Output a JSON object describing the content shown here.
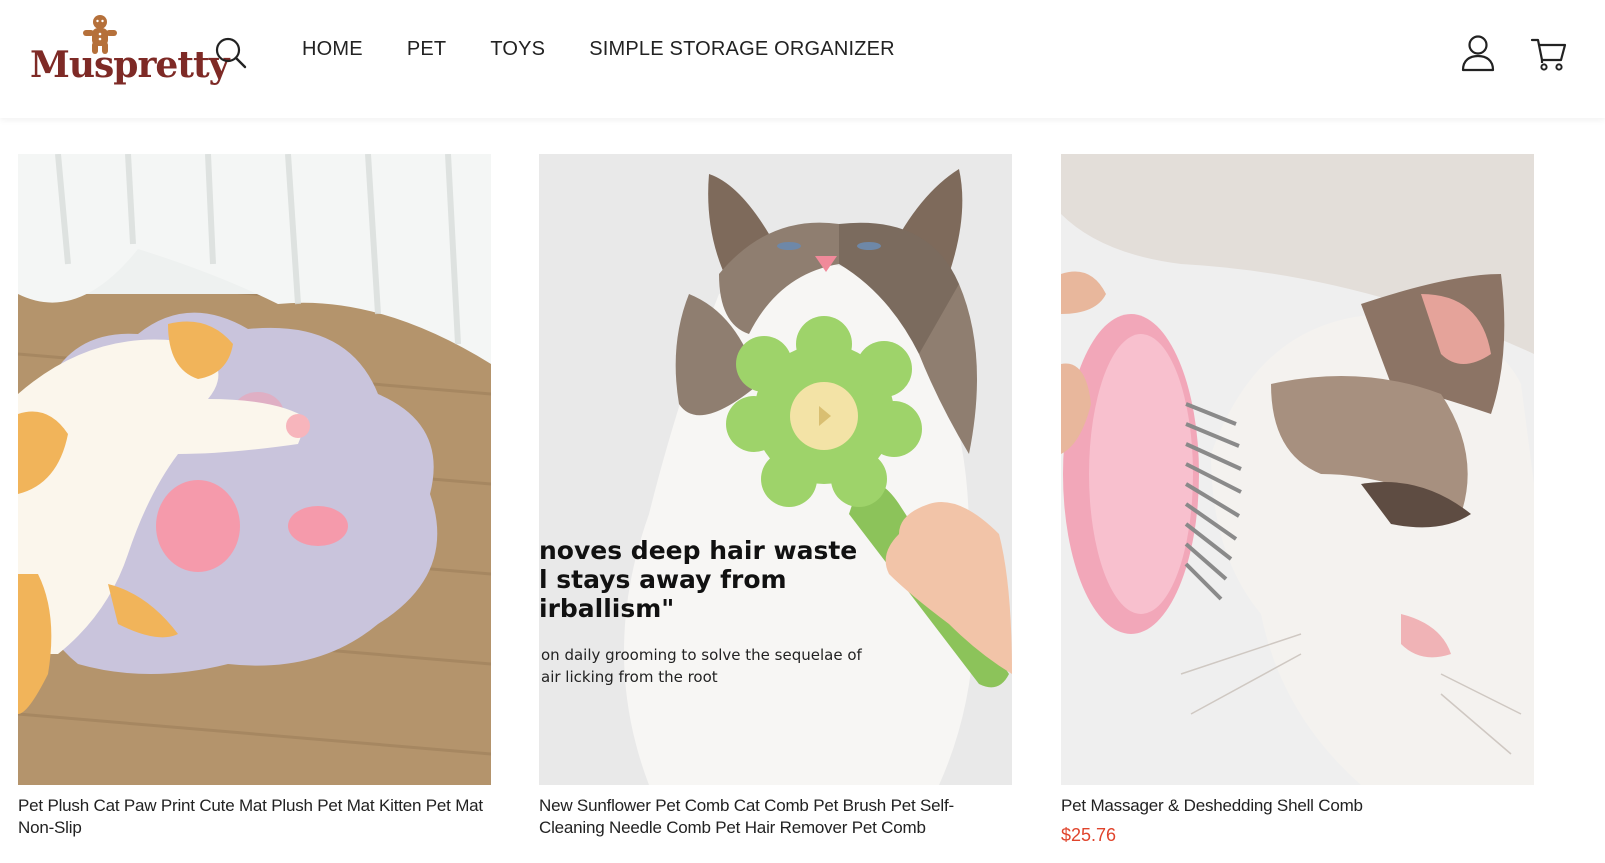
{
  "header": {
    "logo_text": "Muspretty",
    "nav": [
      "HOME",
      "PET",
      "TOYS",
      "SIMPLE STORAGE ORGANIZER"
    ],
    "icons": [
      "search-icon",
      "account-icon",
      "cart-icon"
    ]
  },
  "products": [
    {
      "title": "Pet Plush Cat Paw Print Cute Mat Plush Pet Mat Kitten Pet Mat Non-Slip",
      "price": ""
    },
    {
      "title": "New Sunflower Pet Comb Cat Comb Pet Brush Pet Self-Cleaning Needle Comb Pet Hair Remover Pet Comb",
      "price": "",
      "image_text": {
        "line1": "noves deep hair waste",
        "line2": "l stays away from",
        "line3": "irballism\"",
        "line4": "on daily grooming to solve the sequelae of",
        "line5": "air licking from the root"
      }
    },
    {
      "title": "Pet Massager & Deshedding Shell Comb",
      "price": "$25.76"
    }
  ],
  "colors": {
    "logo": "#7e2a26",
    "price": "#e0442c",
    "text": "#222222"
  }
}
